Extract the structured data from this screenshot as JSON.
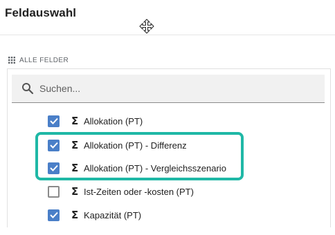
{
  "header": {
    "title": "Feldauswahl"
  },
  "section": {
    "label": "ALLE FELDER"
  },
  "search": {
    "placeholder": "Suchen...",
    "value": ""
  },
  "fields": [
    {
      "label": "Allokation (PT)",
      "checked": true
    },
    {
      "label": "Allokation (PT) - Differenz",
      "checked": true
    },
    {
      "label": "Allokation (PT) - Vergleichsszenario",
      "checked": true
    },
    {
      "label": "Ist-Zeiten oder -kosten (PT)",
      "checked": false
    },
    {
      "label": "Kapazität (PT)",
      "checked": true
    }
  ],
  "colors": {
    "checkbox": "#4a7fc8",
    "highlight": "#1fb8a6"
  }
}
